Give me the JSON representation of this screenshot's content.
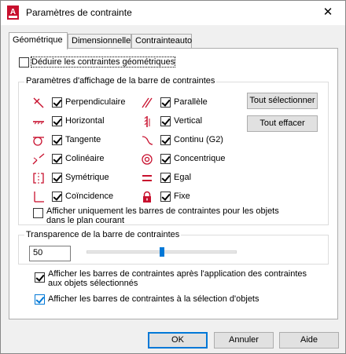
{
  "window": {
    "title": "Paramètres de contrainte"
  },
  "tabs": [
    {
      "label": "Géométrique"
    },
    {
      "label": "Dimensionnelle"
    },
    {
      "label": "Contrainteauto"
    }
  ],
  "infer": {
    "label": "Déduire les contraintes géométriques",
    "checked": false
  },
  "display_group": {
    "title": "Paramètres d'affichage de la barre de contraintes",
    "left_items": [
      {
        "label": "Perpendiculaire",
        "icon": "perpendicular-icon",
        "checked": true
      },
      {
        "label": "Horizontal",
        "icon": "horizontal-icon",
        "checked": true
      },
      {
        "label": "Tangente",
        "icon": "tangent-icon",
        "checked": true
      },
      {
        "label": "Colinéaire",
        "icon": "collinear-icon",
        "checked": true
      },
      {
        "label": "Symétrique",
        "icon": "symmetric-icon",
        "checked": true
      },
      {
        "label": "Coïncidence",
        "icon": "coincident-icon",
        "checked": true
      }
    ],
    "right_items": [
      {
        "label": "Parallèle",
        "icon": "parallel-icon",
        "checked": true
      },
      {
        "label": "Vertical",
        "icon": "vertical-icon",
        "checked": true
      },
      {
        "label": "Continu (G2)",
        "icon": "smooth-icon",
        "checked": true
      },
      {
        "label": "Concentrique",
        "icon": "concentric-icon",
        "checked": true
      },
      {
        "label": "Egal",
        "icon": "equal-icon",
        "checked": true
      },
      {
        "label": "Fixe",
        "icon": "lock-icon",
        "checked": true
      }
    ],
    "select_all": "Tout sélectionner",
    "clear_all": "Tout effacer",
    "current_plane_line1": "Afficher uniquement les barres de contraintes pour les objets",
    "current_plane_line2": "dans le plan courant",
    "current_plane_checked": false
  },
  "transparency": {
    "title": "Transparence de la barre de contraintes",
    "value": "50",
    "level_percent": 50
  },
  "after_apply": {
    "line1": "Afficher les barres de contraintes après l'application des contraintes",
    "line2": "aux objets sélectionnés",
    "checked": true
  },
  "on_select": {
    "label": "Afficher les barres de contraintes à la sélection d'objets",
    "checked": true
  },
  "footer": {
    "ok": "OK",
    "cancel": "Annuler",
    "help": "Aide"
  },
  "colors": {
    "icon_red": "#c8102e",
    "accent": "#0078d7"
  }
}
